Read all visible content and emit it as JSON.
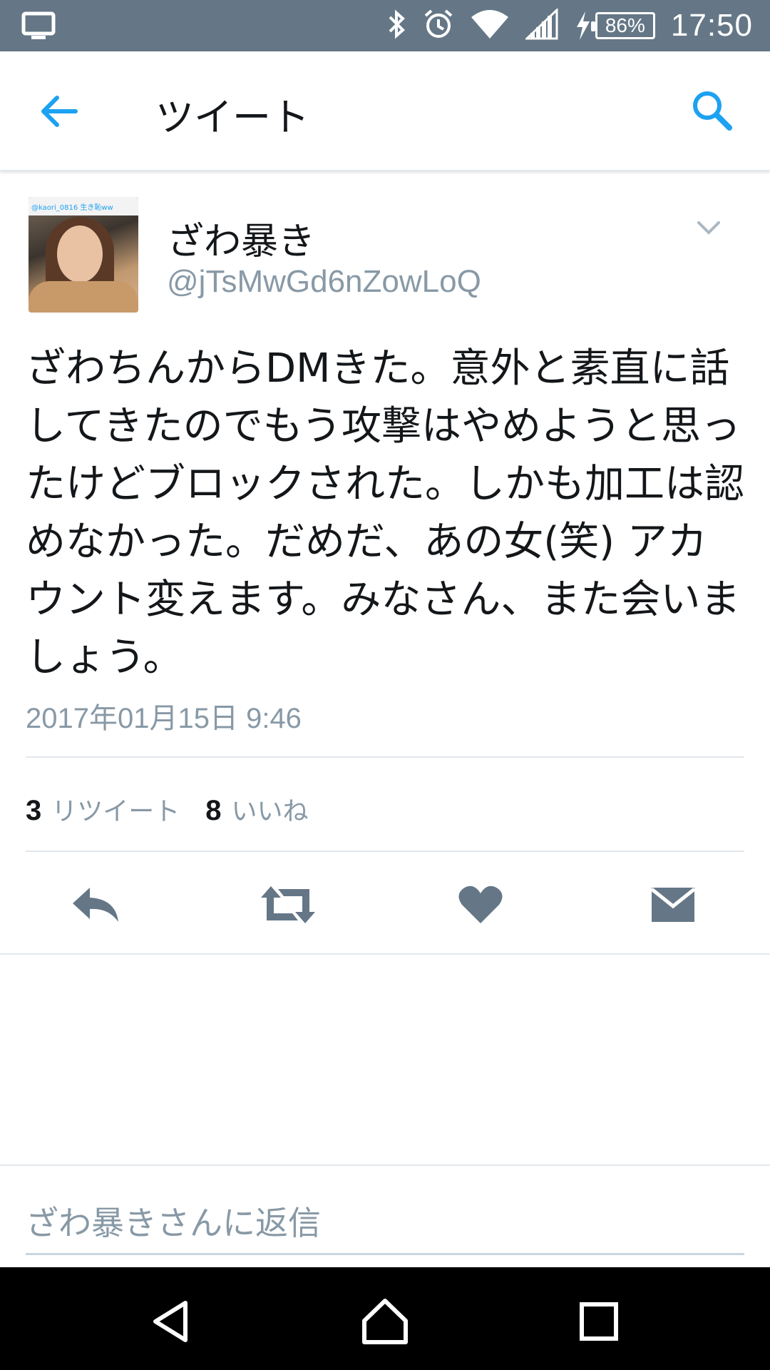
{
  "status_bar": {
    "battery": "86%",
    "time": "17:50",
    "icons": [
      "cast-screen-icon",
      "bluetooth-icon",
      "alarm-icon",
      "wifi-icon",
      "signal-icon",
      "charging-icon"
    ]
  },
  "toolbar": {
    "title": "ツイート",
    "back_icon": "back-arrow-icon",
    "search_icon": "search-icon"
  },
  "tweet": {
    "display_name": "ざわ暴き",
    "handle": "@jTsMwGd6nZowLoQ",
    "avatar_caption": "@kaori_0816 生き恥ww",
    "text": "ざわちんからDMきた。意外と素直に話してきたのでもう攻撃はやめようと思ったけどブロックされた。しかも加工は認めなかった。だめだ、あの女(笑) アカウント変えます。みなさん、また会いましょう。",
    "timestamp": "2017年01月15日 9:46",
    "retweet_count": "3",
    "retweet_label": "リツイート",
    "like_count": "8",
    "like_label": "いいね"
  },
  "actions": {
    "icons": [
      "reply-icon",
      "retweet-icon",
      "like-icon",
      "direct-message-icon"
    ]
  },
  "reply": {
    "placeholder": "ざわ暴きさんに返信"
  },
  "nav_bar": {
    "icons": [
      "nav-back-icon",
      "nav-home-icon",
      "nav-recents-icon"
    ]
  },
  "colors": {
    "status_bar_bg": "#657786",
    "accent": "#1da1f2",
    "icon_gray": "#657786",
    "secondary_text": "#8899a6",
    "divider": "#e1e8ed"
  }
}
